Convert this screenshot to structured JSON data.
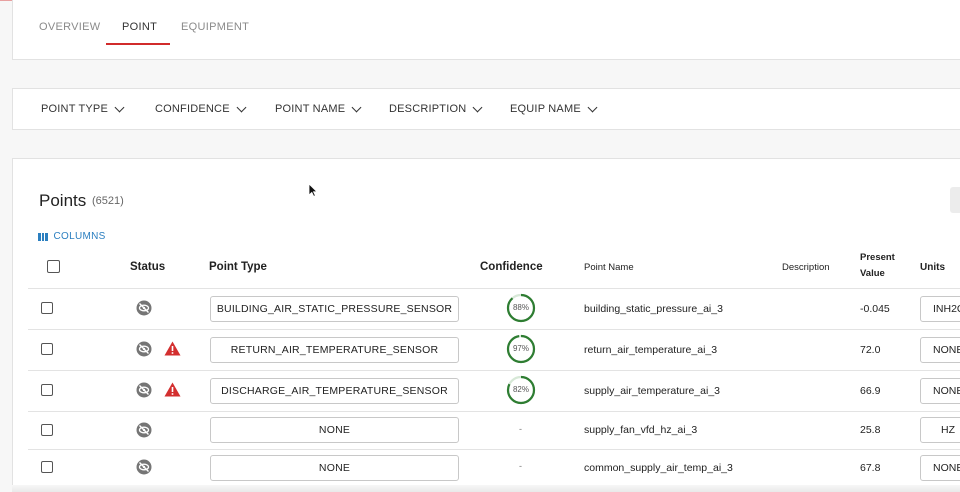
{
  "tabs": [
    {
      "label": "OVERVIEW",
      "active": false
    },
    {
      "label": "POINT",
      "active": true
    },
    {
      "label": "EQUIPMENT",
      "active": false
    }
  ],
  "filters": [
    "POINT TYPE",
    "CONFIDENCE",
    "POINT NAME",
    "DESCRIPTION",
    "EQUIP NAME"
  ],
  "points": {
    "title": "Points",
    "count": "(6521)",
    "columns_label": "COLUMNS",
    "headers": {
      "status": "Status",
      "point_type": "Point Type",
      "confidence": "Confidence",
      "point_name": "Point Name",
      "description": "Description",
      "present_value_1": "Present",
      "present_value_2": "Value",
      "units": "Units"
    },
    "rows": [
      {
        "warning": false,
        "point_type": "BUILDING_AIR_STATIC_PRESSURE_SENSOR",
        "confidence": "88%",
        "confidence_value": 0.88,
        "point_name": "building_static_pressure_ai_3",
        "description": "",
        "present_value": "-0.045",
        "units": "INH2O"
      },
      {
        "warning": true,
        "point_type": "RETURN_AIR_TEMPERATURE_SENSOR",
        "confidence": "97%",
        "confidence_value": 0.97,
        "point_name": "return_air_temperature_ai_3",
        "description": "",
        "present_value": "72.0",
        "units": "NONE"
      },
      {
        "warning": true,
        "point_type": "DISCHARGE_AIR_TEMPERATURE_SENSOR",
        "confidence": "82%",
        "confidence_value": 0.82,
        "point_name": "supply_air_temperature_ai_3",
        "description": "",
        "present_value": "66.9",
        "units": "NONE"
      },
      {
        "warning": false,
        "point_type": "NONE",
        "confidence": "-",
        "confidence_value": null,
        "point_name": "supply_fan_vfd_hz_ai_3",
        "description": "",
        "present_value": "25.8",
        "units": "HZ"
      },
      {
        "warning": false,
        "point_type": "NONE",
        "confidence": "-",
        "confidence_value": null,
        "point_name": "common_supply_air_temp_ai_3",
        "description": "",
        "present_value": "67.8",
        "units": "NONE"
      }
    ]
  },
  "colors": {
    "accent": "#d12b2b",
    "link": "#2b7fc0",
    "confidence_ring": "#2e7d32",
    "warning": "#d32f2f"
  }
}
